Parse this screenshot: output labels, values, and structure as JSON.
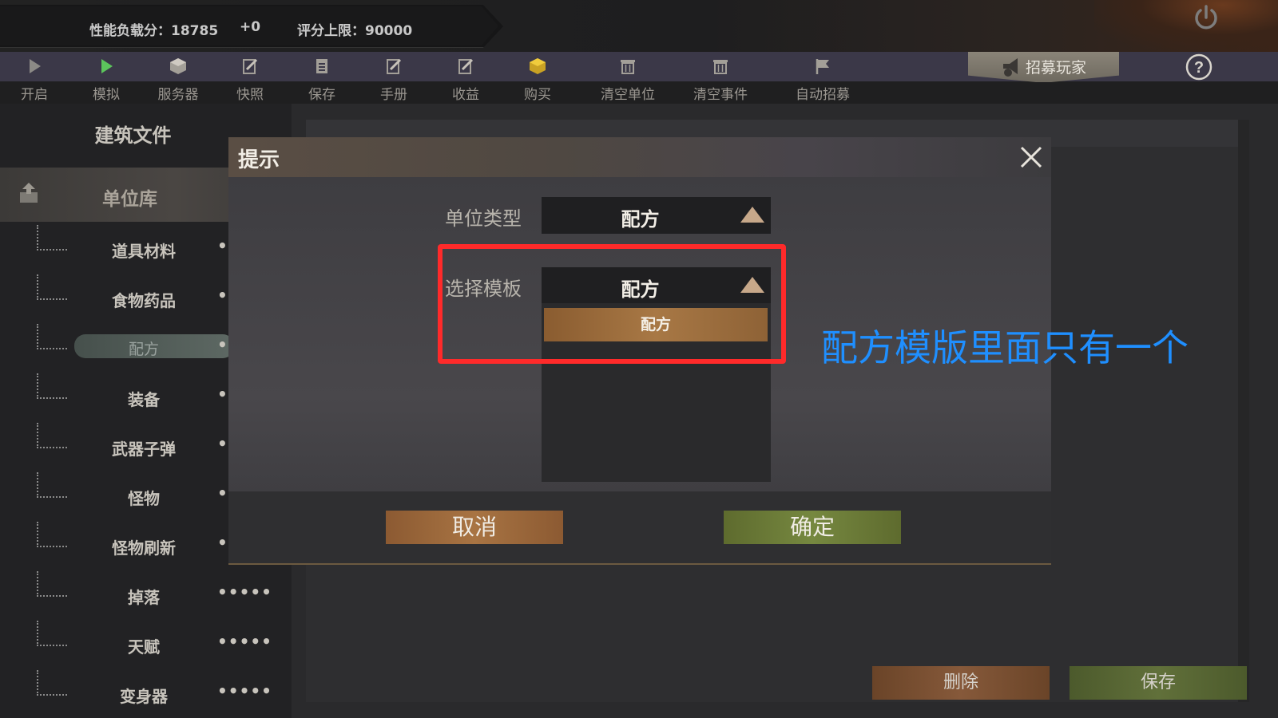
{
  "header": {
    "perf_label": "性能负载分：18785",
    "perf_delta": "+0",
    "score_limit": "评分上限：90000"
  },
  "toolbar": {
    "items": [
      {
        "label": "开启",
        "icon": "play-icon"
      },
      {
        "label": "模拟",
        "icon": "play-green-icon"
      },
      {
        "label": "服务器",
        "icon": "cube-icon"
      },
      {
        "label": "快照",
        "icon": "edit-icon"
      },
      {
        "label": "保存",
        "icon": "document-icon"
      },
      {
        "label": "手册",
        "icon": "edit-icon"
      },
      {
        "label": "收益",
        "icon": "edit-icon"
      },
      {
        "label": "购买",
        "icon": "cube-gold-icon"
      },
      {
        "label": "清空单位",
        "icon": "trash-icon"
      },
      {
        "label": "清空事件",
        "icon": "trash-icon"
      },
      {
        "label": "自动招募",
        "icon": "flag-icon"
      }
    ],
    "recruit_label": "招募玩家"
  },
  "sidebar": {
    "title": "建筑文件",
    "unit_lib": "单位库",
    "items": [
      {
        "label": "道具材料",
        "more": "••"
      },
      {
        "label": "食物药品",
        "more": "••"
      },
      {
        "label": "配方",
        "more": "••"
      },
      {
        "label": "装备",
        "more": "••"
      },
      {
        "label": "武器子弹",
        "more": "••"
      },
      {
        "label": "怪物",
        "more": "••"
      },
      {
        "label": "怪物刷新",
        "more": "••"
      },
      {
        "label": "掉落",
        "more": "•••••"
      },
      {
        "label": "天赋",
        "more": "•••••"
      },
      {
        "label": "变身器",
        "more": "•••••"
      }
    ]
  },
  "main": {
    "delete_label": "删除",
    "save_label": "保存"
  },
  "dialog": {
    "title": "提示",
    "unit_type_label": "单位类型",
    "unit_type_value": "配方",
    "template_label": "选择模板",
    "template_value": "配方",
    "options": [
      "配方"
    ],
    "cancel_label": "取消",
    "confirm_label": "确定"
  },
  "annotation": {
    "text": "配方模版里面只有一个",
    "box_color": "#ff2a2a",
    "text_color": "#1f8fff"
  },
  "colors": {
    "cancel_button": "#a87443",
    "confirm_button": "#768840",
    "option_highlight": "#a87845"
  }
}
